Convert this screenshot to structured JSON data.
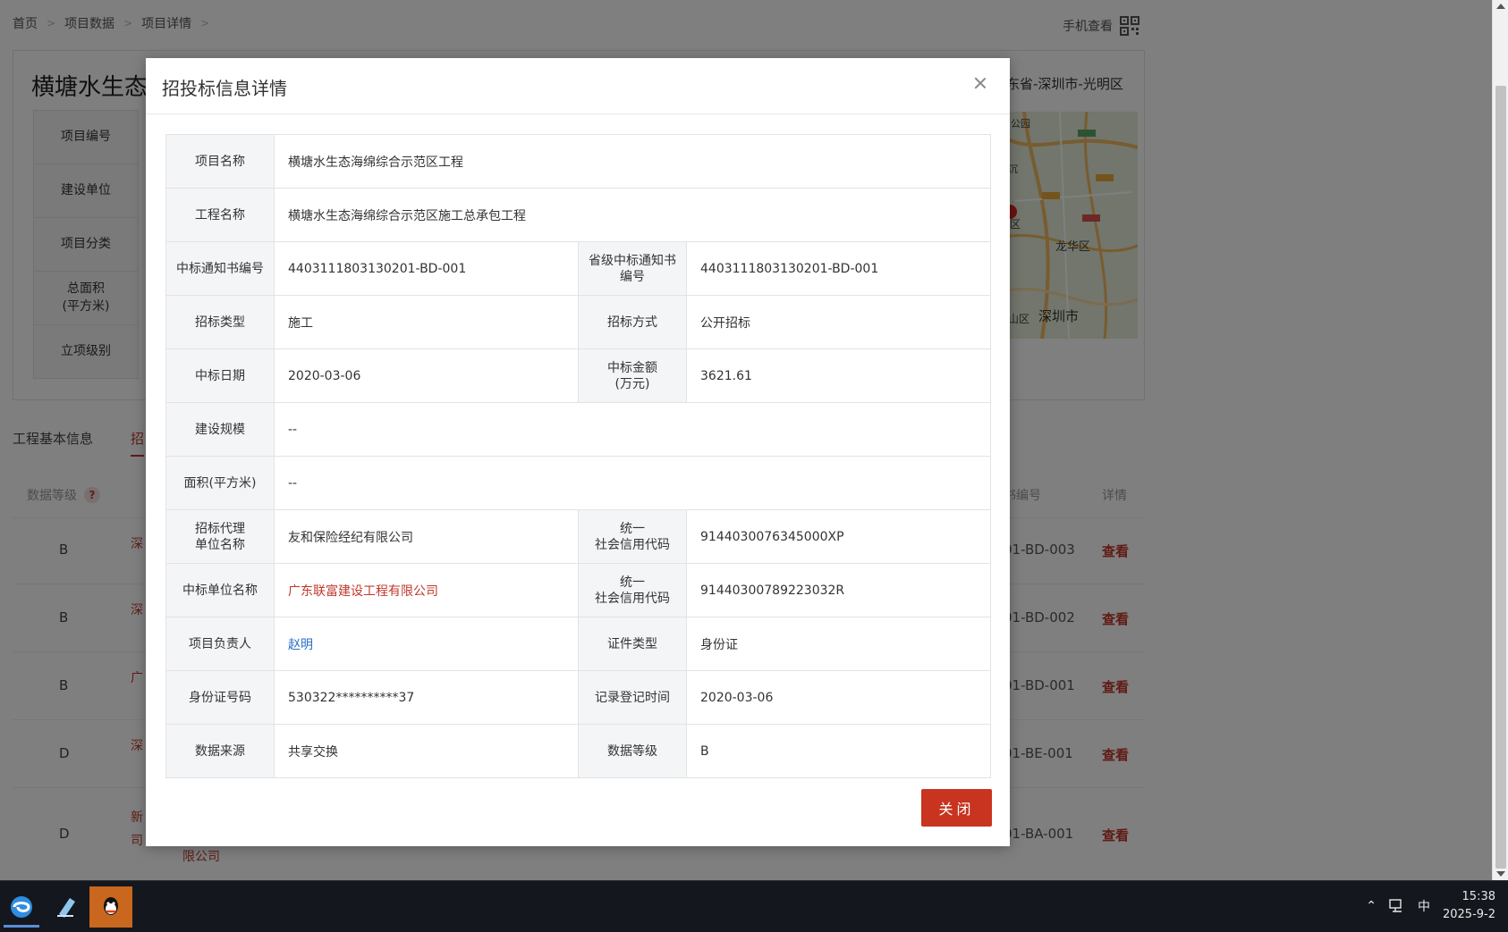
{
  "breadcrumb": [
    "首页",
    "项目数据",
    "项目详情"
  ],
  "header": {
    "mobile_view": "手机查看"
  },
  "project": {
    "title": "横塘水生态",
    "region": "东省-深圳市-光明区",
    "fields": [
      "项目编号",
      "建设单位",
      "项目分类",
      "总面积\n(平方米)",
      "立项级别"
    ],
    "map_labels": [
      "深圳市",
      "龙华区",
      "公园",
      "沉",
      "区",
      "山区"
    ]
  },
  "tabs": [
    {
      "label": "工程基本信息"
    },
    {
      "label": "招"
    }
  ],
  "list": {
    "grade_header": "数据等级",
    "help": "?",
    "code_header": "书编号",
    "detail_header": "详情",
    "rows": [
      {
        "grade": "B",
        "firm": "深",
        "code": "01-BD-003",
        "view": "查看"
      },
      {
        "grade": "B",
        "firm": "深",
        "code": "01-BD-002",
        "view": "查看"
      },
      {
        "grade": "B",
        "firm": "广",
        "code": "01-BD-001",
        "view": "查看"
      },
      {
        "grade": "D",
        "firm": "深",
        "code": "01-BE-001",
        "view": "查看"
      },
      {
        "grade": "D",
        "firm": "新\n司",
        "firm2": "限公司",
        "code": "01-BA-001",
        "view": "查看"
      }
    ]
  },
  "modal": {
    "title": "招投标信息详情",
    "close_button": "关闭",
    "fields": {
      "project_name_label": "项目名称",
      "project_name": "横塘水生态海绵综合示范区工程",
      "work_name_label": "工程名称",
      "work_name": "横塘水生态海绵综合示范区施工总承包工程",
      "notice_no_label": "中标通知书编号",
      "notice_no": "4403111803130201-BD-001",
      "prov_notice_no_label": "省级中标通知书编号",
      "prov_notice_no": "4403111803130201-BD-001",
      "bid_type_label": "招标类型",
      "bid_type": "施工",
      "bid_method_label": "招标方式",
      "bid_method": "公开招标",
      "win_date_label": "中标日期",
      "win_date": "2020-03-06",
      "win_amount_label": "中标金额\n(万元)",
      "win_amount": "3621.61",
      "scale_label": "建设规模",
      "scale": "--",
      "area_label": "面积(平方米)",
      "area": "--",
      "agent_label": "招标代理\n单位名称",
      "agent": "友和保险经纪有限公司",
      "agent_code_label": "统一\n社会信用代码",
      "agent_code": "9144030076345000XP",
      "winner_label": "中标单位名称",
      "winner": "广东联富建设工程有限公司",
      "winner_code_label": "统一\n社会信用代码",
      "winner_code": "91440300789223032R",
      "manager_label": "项目负责人",
      "manager": "赵明",
      "id_type_label": "证件类型",
      "id_type": "身份证",
      "id_no_label": "身份证号码",
      "id_no": "530322**********37",
      "record_time_label": "记录登记时间",
      "record_time": "2020-03-06",
      "source_label": "数据来源",
      "source": "共享交换",
      "grade_label": "数据等级",
      "grade": "B"
    }
  },
  "taskbar": {
    "apps": [
      "browser-icon",
      "notepad-icon",
      "qq-icon"
    ],
    "tray": {
      "ime": "中",
      "time": "15:38",
      "date": "2025-9-2"
    }
  },
  "colors": {
    "accent_red": "#c8341f",
    "link_blue": "#2a6fc9",
    "overlay": "rgba(0,0,0,0.5)"
  }
}
